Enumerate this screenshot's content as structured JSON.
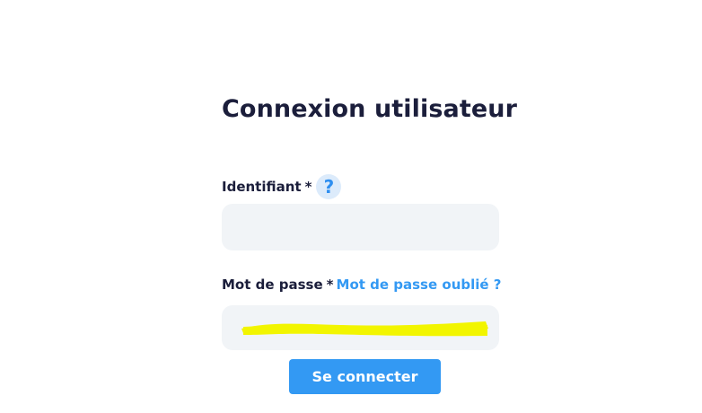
{
  "login": {
    "title": "Connexion utilisateur",
    "username": {
      "label": "Identifiant",
      "required_mark": "*",
      "help_symbol": "?",
      "value": ""
    },
    "password": {
      "label": "Mot de passe",
      "required_mark": "*",
      "forgot_link": "Mot de passe oublié ?",
      "redacted": true
    },
    "submit_label": "Se connecter"
  },
  "colors": {
    "accent": "#3399f3",
    "title_text": "#1b1e3b",
    "field_background": "#f1f4f7",
    "help_background": "#dcebfb",
    "redaction": "#f2f500"
  },
  "icons": {
    "help": "question-mark-icon"
  }
}
